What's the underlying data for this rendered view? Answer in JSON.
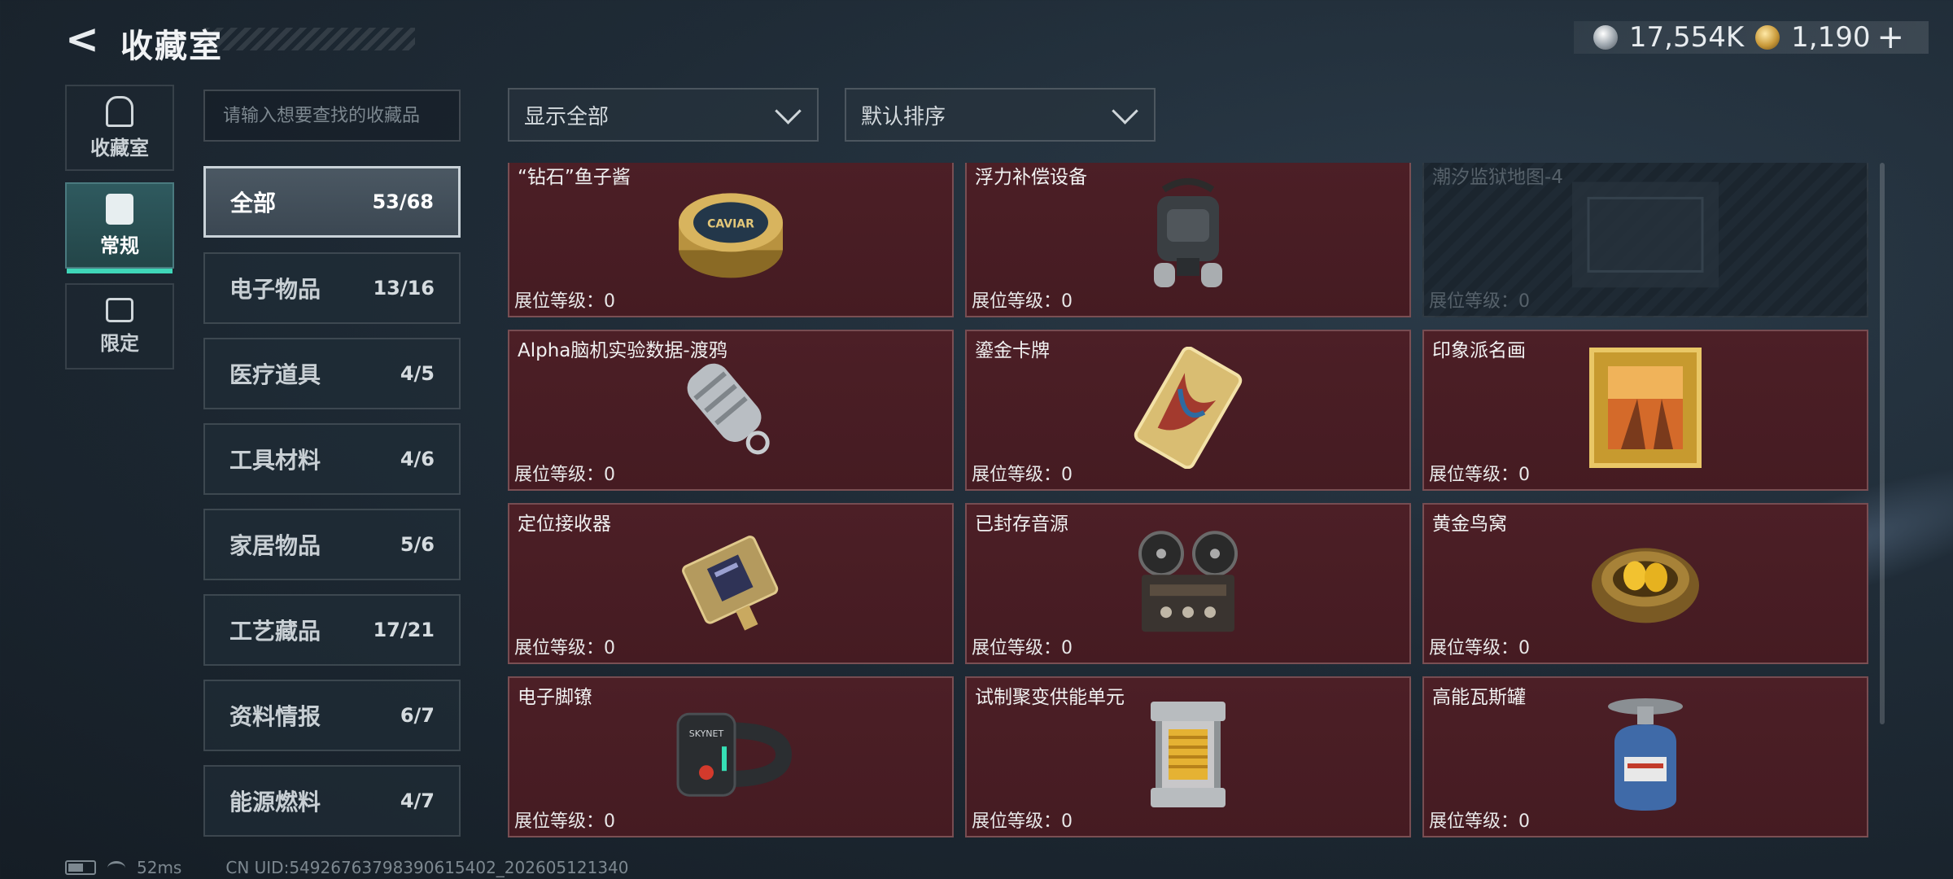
{
  "header": {
    "title": "收藏室",
    "currency": [
      {
        "icon": "silver-coin-icon",
        "value": "17,554K"
      },
      {
        "icon": "gold-coin-icon",
        "value": "1,190"
      }
    ],
    "plus_label": "+"
  },
  "sidenav": [
    {
      "label": "收藏室",
      "icon": "trophy-icon",
      "active": false
    },
    {
      "label": "常规",
      "icon": "general-collection-icon",
      "active": true
    },
    {
      "label": "限定",
      "icon": "limited-collection-icon",
      "active": false
    }
  ],
  "search": {
    "placeholder": "请输入想要查找的收藏品"
  },
  "filters": {
    "display": "显示全部",
    "sort": "默认排序"
  },
  "categories": [
    {
      "name": "全部",
      "count": "53/68",
      "active": true
    },
    {
      "name": "电子物品",
      "count": "13/16"
    },
    {
      "name": "医疗道具",
      "count": "4/5"
    },
    {
      "name": "工具材料",
      "count": "4/6"
    },
    {
      "name": "家居物品",
      "count": "5/6"
    },
    {
      "name": "工艺藏品",
      "count": "17/21"
    },
    {
      "name": "资料情报",
      "count": "6/7"
    },
    {
      "name": "能源燃料",
      "count": "4/7"
    }
  ],
  "level_label": "展位等级：",
  "items": [
    {
      "name": "“钻石”鱼子酱",
      "level": "0",
      "icon": "caviar-tin-icon",
      "caption": "CAVIAR"
    },
    {
      "name": "浮力补偿设备",
      "level": "0",
      "icon": "buoyancy-device-icon"
    },
    {
      "name": "潮汐监狱地图-4",
      "level": "0",
      "icon": "map-icon",
      "locked": true
    },
    {
      "name": "Alpha脑机实验数据-渡鸦",
      "level": "0",
      "icon": "data-capsule-icon"
    },
    {
      "name": "鎏金卡牌",
      "level": "0",
      "icon": "gilded-card-icon"
    },
    {
      "name": "印象派名画",
      "level": "0",
      "icon": "framed-painting-icon"
    },
    {
      "name": "定位接收器",
      "level": "0",
      "icon": "locator-receiver-icon"
    },
    {
      "name": "已封存音源",
      "level": "0",
      "icon": "tape-recorder-icon"
    },
    {
      "name": "黄金鸟窝",
      "level": "0",
      "icon": "golden-nest-icon"
    },
    {
      "name": "电子脚镣",
      "level": "0",
      "icon": "ankle-monitor-icon",
      "caption": "SKYNET"
    },
    {
      "name": "试制聚变供能单元",
      "level": "0",
      "icon": "fusion-cell-icon"
    },
    {
      "name": "高能瓦斯罐",
      "level": "0",
      "icon": "gas-canister-icon"
    }
  ],
  "footer": {
    "ping": "52ms",
    "uid": "CN UID:54926763798390615402_202605121340"
  }
}
